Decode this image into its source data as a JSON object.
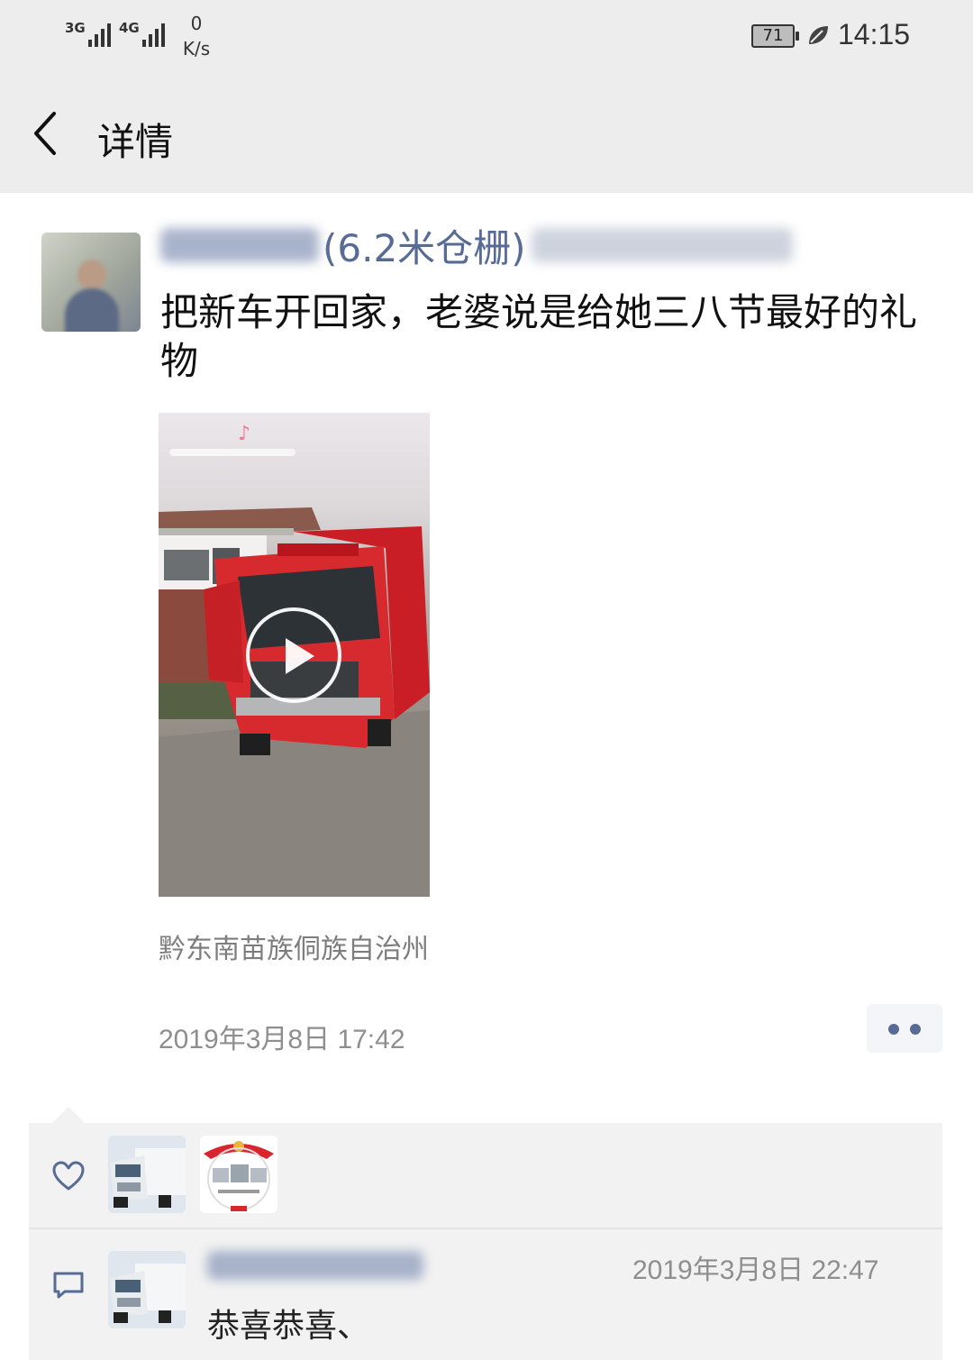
{
  "status_bar": {
    "network_1": "3G",
    "network_2": "4G",
    "speed_value": "0",
    "speed_unit": "K/s",
    "battery": "71",
    "time": "14:15"
  },
  "nav": {
    "back_icon": "chevron-left-icon",
    "title": "详情"
  },
  "post": {
    "author_visible": "(6.2米仓栅)",
    "text": "把新车开回家，老婆说是给她三八节最好的礼物",
    "video": {
      "type": "video",
      "play_icon": "play-icon"
    },
    "location": "黔东南苗族侗族自治州",
    "timestamp": "2019年3月8日 17:42",
    "more_icon": "more-dots-icon"
  },
  "interactions": {
    "likes_icon": "heart-icon",
    "likes": [
      {
        "avatar": "truck-avatar"
      },
      {
        "avatar": "logo-avatar"
      }
    ],
    "comments_icon": "comment-icon",
    "comments": [
      {
        "time": "2019年3月8日 22:47",
        "text": "恭喜恭喜、"
      }
    ]
  },
  "colors": {
    "link": "#576b95",
    "header_bg": "#ededed",
    "panel_bg": "#f2f2f2",
    "truck_red": "#d4242a"
  }
}
